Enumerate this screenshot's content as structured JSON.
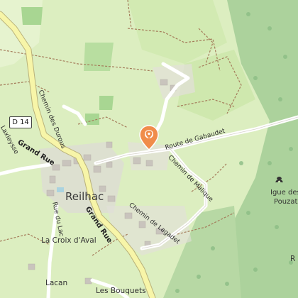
{
  "map": {
    "route_shield": "D 14",
    "places": {
      "town": "Reilhac",
      "croix": "La Croix d'Aval",
      "lacan": "Lacan",
      "bouquets": "Les Bouquets",
      "igue_line1": "Igue des",
      "igue_line2": "Pouzats",
      "edge_r": "R"
    },
    "roads": {
      "grand_rue_north": "Grand Rue",
      "grand_rue_south": "Grand Rue",
      "gabaudet": "Route de Gabaudet",
      "malique": "Chemin de Malique",
      "lagadet": "Chemin de Lagadet",
      "durous": "Chemin des Durous",
      "lac": "Rue du Lac",
      "laxleysse": "Laxleysse"
    },
    "icons": {
      "marker": "location-pin-icon",
      "cave": "cave-icon"
    },
    "colors": {
      "marker": "#f08c4a",
      "main_road": "#f7f5a8",
      "forest": "#acd29c",
      "meadow": "#dceec0"
    }
  }
}
